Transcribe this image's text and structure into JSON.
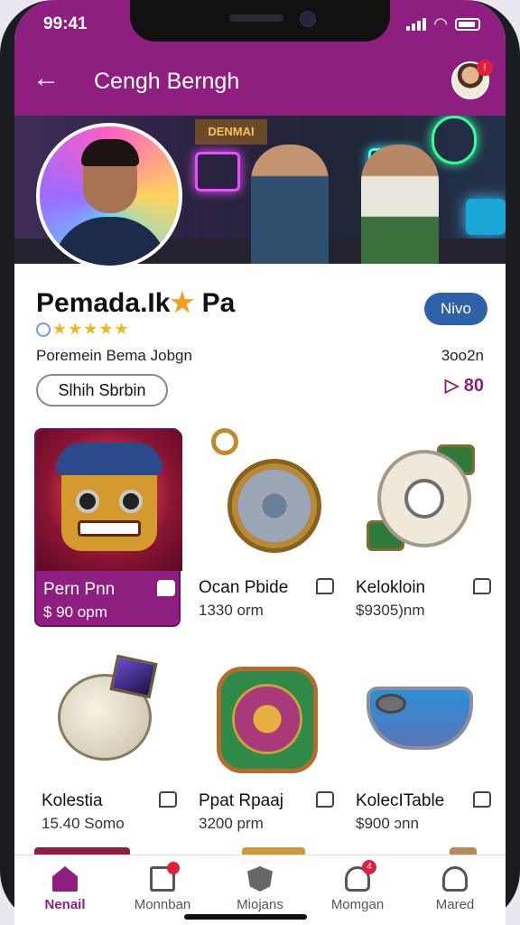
{
  "status": {
    "time": "99:41"
  },
  "header": {
    "title": "Cengh Berngh",
    "notification_count": "!"
  },
  "profile": {
    "name": "Pemada.Ik",
    "name_suffix": "Pa",
    "stars": "★★★★★",
    "subtitle": "Poremein Bema Jobgn",
    "pill_button": "Slhih Sbrbin",
    "level_button": "Nivo",
    "count": "3oo2n",
    "share": "▷ 80"
  },
  "banner": {
    "sign": "DENMAI"
  },
  "items": [
    {
      "label": "Pern Pnn",
      "price": "$ 90 opm"
    },
    {
      "label": "Ocan Pbide",
      "price": "1330 orm"
    },
    {
      "label": "Kelokloin",
      "price": "$9305)nm"
    },
    {
      "label": "Kolestia",
      "price": "15.40 Somo"
    },
    {
      "label": "Ppat Rpaaj",
      "price": "3200 prm"
    },
    {
      "label": "KolecITable",
      "price": "$900 ɔnn"
    }
  ],
  "tabs": [
    {
      "label": "Nenail",
      "badge": ""
    },
    {
      "label": "Monnban",
      "badge": ""
    },
    {
      "label": "Miojans",
      "badge": ""
    },
    {
      "label": "Momgan",
      "badge": "4"
    },
    {
      "label": "Mared",
      "badge": ""
    }
  ],
  "colors": {
    "accent": "#8e1f80",
    "level_button": "#2f61a8",
    "star": "#f3b51c"
  }
}
